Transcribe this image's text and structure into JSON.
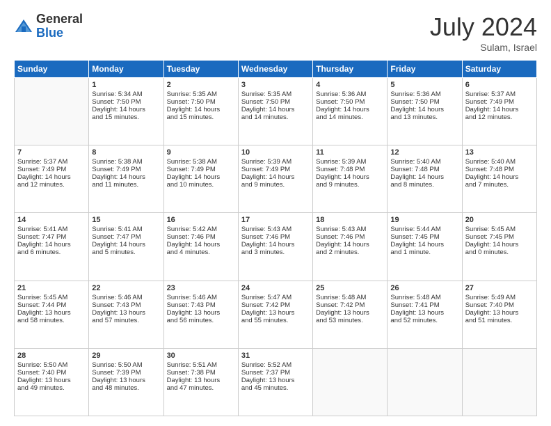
{
  "header": {
    "logo_general": "General",
    "logo_blue": "Blue",
    "month_year": "July 2024",
    "location": "Sulam, Israel"
  },
  "days_of_week": [
    "Sunday",
    "Monday",
    "Tuesday",
    "Wednesday",
    "Thursday",
    "Friday",
    "Saturday"
  ],
  "weeks": [
    [
      {
        "day": "",
        "info": ""
      },
      {
        "day": "1",
        "info": "Sunrise: 5:34 AM\nSunset: 7:50 PM\nDaylight: 14 hours\nand 15 minutes."
      },
      {
        "day": "2",
        "info": "Sunrise: 5:35 AM\nSunset: 7:50 PM\nDaylight: 14 hours\nand 15 minutes."
      },
      {
        "day": "3",
        "info": "Sunrise: 5:35 AM\nSunset: 7:50 PM\nDaylight: 14 hours\nand 14 minutes."
      },
      {
        "day": "4",
        "info": "Sunrise: 5:36 AM\nSunset: 7:50 PM\nDaylight: 14 hours\nand 14 minutes."
      },
      {
        "day": "5",
        "info": "Sunrise: 5:36 AM\nSunset: 7:50 PM\nDaylight: 14 hours\nand 13 minutes."
      },
      {
        "day": "6",
        "info": "Sunrise: 5:37 AM\nSunset: 7:49 PM\nDaylight: 14 hours\nand 12 minutes."
      }
    ],
    [
      {
        "day": "7",
        "info": "Sunrise: 5:37 AM\nSunset: 7:49 PM\nDaylight: 14 hours\nand 12 minutes."
      },
      {
        "day": "8",
        "info": "Sunrise: 5:38 AM\nSunset: 7:49 PM\nDaylight: 14 hours\nand 11 minutes."
      },
      {
        "day": "9",
        "info": "Sunrise: 5:38 AM\nSunset: 7:49 PM\nDaylight: 14 hours\nand 10 minutes."
      },
      {
        "day": "10",
        "info": "Sunrise: 5:39 AM\nSunset: 7:49 PM\nDaylight: 14 hours\nand 9 minutes."
      },
      {
        "day": "11",
        "info": "Sunrise: 5:39 AM\nSunset: 7:48 PM\nDaylight: 14 hours\nand 9 minutes."
      },
      {
        "day": "12",
        "info": "Sunrise: 5:40 AM\nSunset: 7:48 PM\nDaylight: 14 hours\nand 8 minutes."
      },
      {
        "day": "13",
        "info": "Sunrise: 5:40 AM\nSunset: 7:48 PM\nDaylight: 14 hours\nand 7 minutes."
      }
    ],
    [
      {
        "day": "14",
        "info": "Sunrise: 5:41 AM\nSunset: 7:47 PM\nDaylight: 14 hours\nand 6 minutes."
      },
      {
        "day": "15",
        "info": "Sunrise: 5:41 AM\nSunset: 7:47 PM\nDaylight: 14 hours\nand 5 minutes."
      },
      {
        "day": "16",
        "info": "Sunrise: 5:42 AM\nSunset: 7:46 PM\nDaylight: 14 hours\nand 4 minutes."
      },
      {
        "day": "17",
        "info": "Sunrise: 5:43 AM\nSunset: 7:46 PM\nDaylight: 14 hours\nand 3 minutes."
      },
      {
        "day": "18",
        "info": "Sunrise: 5:43 AM\nSunset: 7:46 PM\nDaylight: 14 hours\nand 2 minutes."
      },
      {
        "day": "19",
        "info": "Sunrise: 5:44 AM\nSunset: 7:45 PM\nDaylight: 14 hours\nand 1 minute."
      },
      {
        "day": "20",
        "info": "Sunrise: 5:45 AM\nSunset: 7:45 PM\nDaylight: 14 hours\nand 0 minutes."
      }
    ],
    [
      {
        "day": "21",
        "info": "Sunrise: 5:45 AM\nSunset: 7:44 PM\nDaylight: 13 hours\nand 58 minutes."
      },
      {
        "day": "22",
        "info": "Sunrise: 5:46 AM\nSunset: 7:43 PM\nDaylight: 13 hours\nand 57 minutes."
      },
      {
        "day": "23",
        "info": "Sunrise: 5:46 AM\nSunset: 7:43 PM\nDaylight: 13 hours\nand 56 minutes."
      },
      {
        "day": "24",
        "info": "Sunrise: 5:47 AM\nSunset: 7:42 PM\nDaylight: 13 hours\nand 55 minutes."
      },
      {
        "day": "25",
        "info": "Sunrise: 5:48 AM\nSunset: 7:42 PM\nDaylight: 13 hours\nand 53 minutes."
      },
      {
        "day": "26",
        "info": "Sunrise: 5:48 AM\nSunset: 7:41 PM\nDaylight: 13 hours\nand 52 minutes."
      },
      {
        "day": "27",
        "info": "Sunrise: 5:49 AM\nSunset: 7:40 PM\nDaylight: 13 hours\nand 51 minutes."
      }
    ],
    [
      {
        "day": "28",
        "info": "Sunrise: 5:50 AM\nSunset: 7:40 PM\nDaylight: 13 hours\nand 49 minutes."
      },
      {
        "day": "29",
        "info": "Sunrise: 5:50 AM\nSunset: 7:39 PM\nDaylight: 13 hours\nand 48 minutes."
      },
      {
        "day": "30",
        "info": "Sunrise: 5:51 AM\nSunset: 7:38 PM\nDaylight: 13 hours\nand 47 minutes."
      },
      {
        "day": "31",
        "info": "Sunrise: 5:52 AM\nSunset: 7:37 PM\nDaylight: 13 hours\nand 45 minutes."
      },
      {
        "day": "",
        "info": ""
      },
      {
        "day": "",
        "info": ""
      },
      {
        "day": "",
        "info": ""
      }
    ]
  ]
}
